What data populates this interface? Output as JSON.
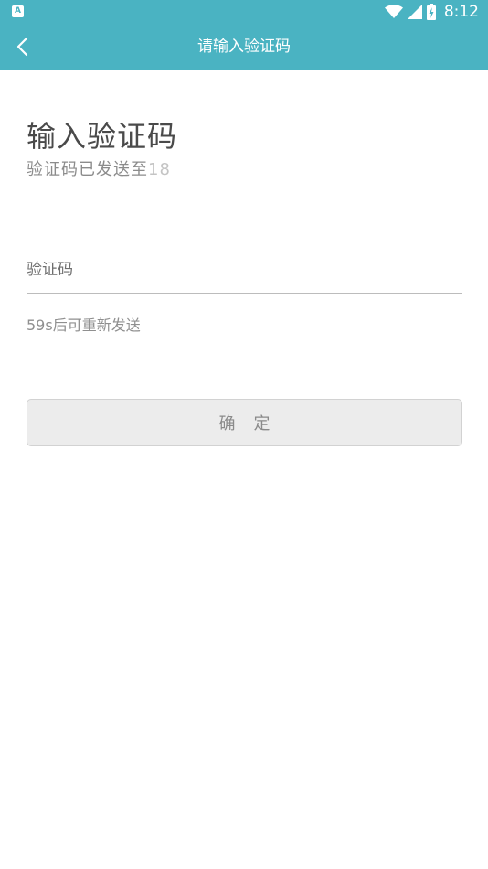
{
  "status_bar": {
    "notification_icon": "a-notification-icon",
    "notification_letter": "A",
    "wifi_icon": "wifi-icon",
    "signal_icon": "cell-signal-icon",
    "battery_icon": "battery-charging-icon",
    "time": "8:12"
  },
  "app_bar": {
    "back_icon": "chevron-left-icon",
    "title": "请输入验证码"
  },
  "main": {
    "heading": "输入验证码",
    "subtitle_prefix": "验证码已发送至",
    "subtitle_phone": "18",
    "code_input": {
      "placeholder": "验证码",
      "value": ""
    },
    "resend_text": "59s后可重新发送",
    "confirm_label": "确定"
  },
  "colors": {
    "primary": "#4ab3c2",
    "button_bg": "#ececec",
    "text_dark": "#4a4a4a",
    "text_muted": "#8c8c8c"
  }
}
